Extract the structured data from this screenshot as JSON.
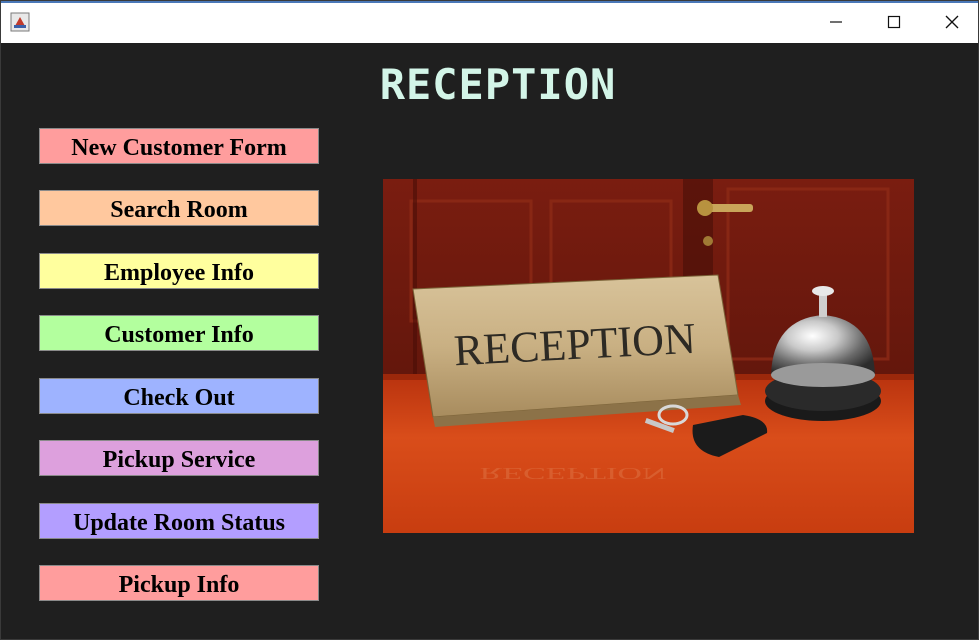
{
  "window": {
    "title": "",
    "controls": {
      "minimize": "minimize",
      "maximize": "maximize",
      "close": "close"
    }
  },
  "heading": "RECEPTION",
  "menu": [
    {
      "label": "New Customer Form",
      "color": "#ff9d9d"
    },
    {
      "label": "Search Room",
      "color": "#ffc89e"
    },
    {
      "label": "Employee Info",
      "color": "#ffff9e"
    },
    {
      "label": "Customer Info",
      "color": "#b3ff9e"
    },
    {
      "label": "Check Out",
      "color": "#9eb3ff"
    },
    {
      "label": "Pickup Service",
      "color": "#dda0dd"
    },
    {
      "label": "Update Room Status",
      "color": "#b39eff"
    },
    {
      "label": "Pickup Info",
      "color": "#ff9d9d"
    }
  ],
  "photo": {
    "sign_text": "RECEPTION",
    "icons": [
      "reception-bell-icon",
      "key-icon"
    ]
  },
  "colors": {
    "background": "#1f1f1f",
    "heading": "#d3f5e8",
    "titlebar": "#ffffff"
  }
}
